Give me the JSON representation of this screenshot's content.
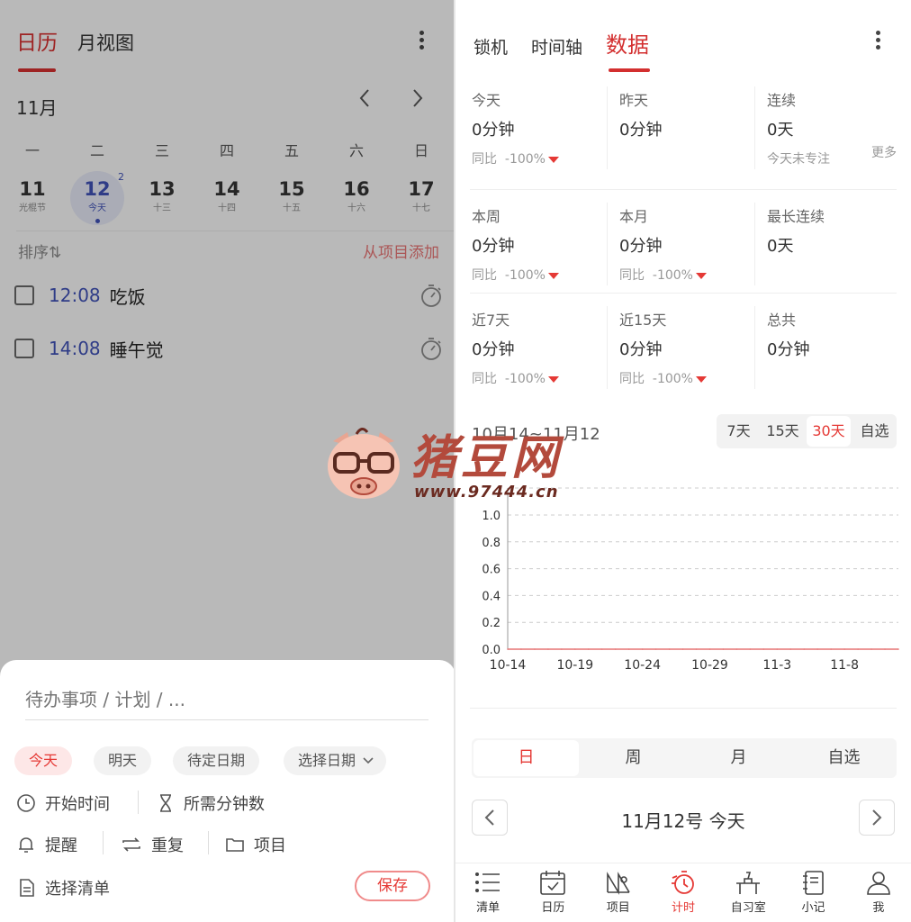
{
  "left": {
    "tabs": [
      "日历",
      "月视图"
    ],
    "month": "11月",
    "weekdays": [
      "一",
      "二",
      "三",
      "四",
      "五",
      "六",
      "日"
    ],
    "days": [
      {
        "num": "11",
        "sub": "光棍节"
      },
      {
        "num": "12",
        "sub": "今天",
        "badge": "2"
      },
      {
        "num": "13",
        "sub": "十三"
      },
      {
        "num": "14",
        "sub": "十四"
      },
      {
        "num": "15",
        "sub": "十五"
      },
      {
        "num": "16",
        "sub": "十六"
      },
      {
        "num": "17",
        "sub": "十七"
      }
    ],
    "sort_label": "排序⇅",
    "add_from_project": "从项目添加",
    "tasks": [
      {
        "time": "12:08",
        "title": "吃饭"
      },
      {
        "time": "14:08",
        "title": "睡午觉"
      }
    ],
    "sheet": {
      "placeholder": "待办事项 / 计划 / ...",
      "chips": [
        "今天",
        "明天",
        "待定日期",
        "选择日期"
      ],
      "options": {
        "start_time": "开始时间",
        "minutes_needed": "所需分钟数",
        "reminder": "提醒",
        "repeat": "重复",
        "project": "项目",
        "select_list": "选择清单"
      },
      "save": "保存"
    }
  },
  "right": {
    "tabs": [
      "锁机",
      "时间轴",
      "数据"
    ],
    "stats": [
      [
        {
          "label": "今天",
          "value": "0分钟",
          "cmp_label": "同比",
          "cmp_value": "-100%"
        },
        {
          "label": "昨天",
          "value": "0分钟"
        },
        {
          "label": "连续",
          "value": "0天",
          "note": "今天未专注",
          "more": "更多"
        }
      ],
      [
        {
          "label": "本周",
          "value": "0分钟",
          "cmp_label": "同比",
          "cmp_value": "-100%"
        },
        {
          "label": "本月",
          "value": "0分钟",
          "cmp_label": "同比",
          "cmp_value": "-100%"
        },
        {
          "label": "最长连续",
          "value": "0天"
        }
      ],
      [
        {
          "label": "近7天",
          "value": "0分钟",
          "cmp_label": "同比",
          "cmp_value": "-100%"
        },
        {
          "label": "近15天",
          "value": "0分钟",
          "cmp_label": "同比",
          "cmp_value": "-100%"
        },
        {
          "label": "总共",
          "value": "0分钟"
        }
      ]
    ],
    "range_label": "10月14~11月12",
    "range_options": [
      "7天",
      "15天",
      "30天",
      "自选"
    ],
    "range_selected": "30天",
    "period_options": [
      "日",
      "周",
      "月",
      "自选"
    ],
    "period_selected": "日",
    "date_label": "11月12号 今天",
    "nav": [
      "清单",
      "日历",
      "项目",
      "计时",
      "自习室",
      "小记",
      "我"
    ],
    "nav_active": "计时"
  },
  "watermark": {
    "title": "猪豆网",
    "url": "www.97444.cn"
  },
  "chart_data": {
    "type": "line",
    "x": [
      "10-14",
      "10-15",
      "10-16",
      "10-17",
      "10-18",
      "10-19",
      "10-20",
      "10-21",
      "10-22",
      "10-23",
      "10-24",
      "10-25",
      "10-26",
      "10-27",
      "10-28",
      "10-29",
      "10-30",
      "10-31",
      "11-1",
      "11-2",
      "11-3",
      "11-4",
      "11-5",
      "11-6",
      "11-7",
      "11-8",
      "11-9",
      "11-10",
      "11-11",
      "11-12"
    ],
    "xticks": [
      "10-14",
      "10-19",
      "10-24",
      "10-29",
      "11-3",
      "11-8"
    ],
    "series": [
      {
        "values": [
          0,
          0,
          0,
          0,
          0,
          0,
          0,
          0,
          0,
          0,
          0,
          0,
          0,
          0,
          0,
          0,
          0,
          0,
          0,
          0,
          0,
          0,
          0,
          0,
          0,
          0,
          0,
          0,
          0,
          0
        ]
      }
    ],
    "yticks": [
      "0.0",
      "0.2",
      "0.4",
      "0.6",
      "0.8",
      "1.0"
    ],
    "ylim": [
      0,
      1.0
    ],
    "grid": true,
    "line_color": "#e57373"
  }
}
